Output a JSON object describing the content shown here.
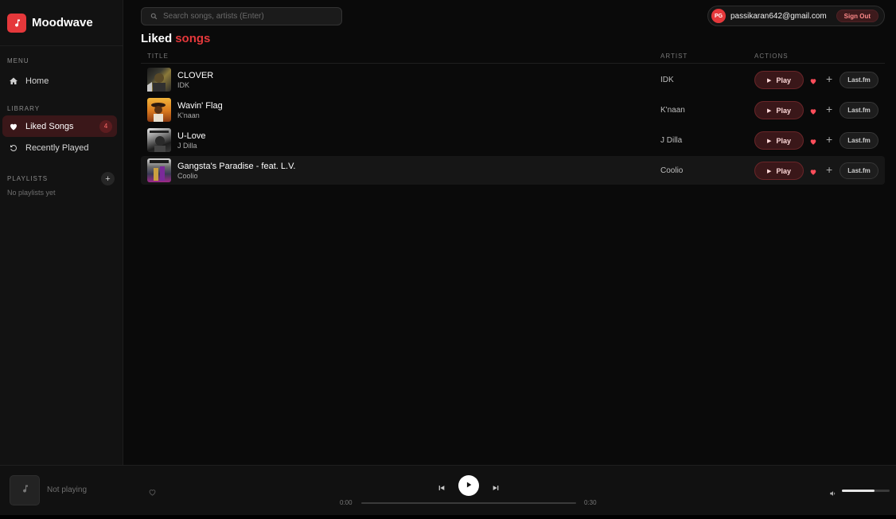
{
  "brand": {
    "name": "Moodwave",
    "icon": "music-note-icon",
    "color": "#e5383b"
  },
  "sidebar": {
    "menu_label": "MENU",
    "home_label": "Home",
    "library_label": "LIBRARY",
    "liked_label": "Liked Songs",
    "liked_count": "4",
    "recent_label": "Recently Played",
    "playlists_label": "PLAYLISTS",
    "add_playlist": "+",
    "no_playlists": "No playlists yet"
  },
  "search": {
    "placeholder": "Search songs, artists (Enter)",
    "value": ""
  },
  "user": {
    "initials": "PG",
    "email": "passikaran642@gmail.com",
    "signout_label": "Sign Out"
  },
  "page": {
    "title_plain": "Liked",
    "title_accent": "songs"
  },
  "table": {
    "columns": {
      "title": "TITLE",
      "artist": "ARTIST",
      "actions": "ACTIONS"
    },
    "play_label": "Play",
    "lastfm_label": "Last.fm",
    "add_label": "+",
    "rows": [
      {
        "title": "CLOVER",
        "subtitle": "IDK",
        "artist": "IDK"
      },
      {
        "title": "Wavin' Flag",
        "subtitle": "K'naan",
        "artist": "K'naan"
      },
      {
        "title": "U-Love",
        "subtitle": "J Dilla",
        "artist": "J Dilla"
      },
      {
        "title": "Gangsta's Paradise - feat. L.V.",
        "subtitle": "Coolio",
        "artist": "Coolio"
      }
    ]
  },
  "player": {
    "now_playing": "Not playing",
    "time_current": "0:00",
    "time_total": "0:30",
    "progress": 0,
    "volume": 0.68
  },
  "colors": {
    "accent": "#e5383b",
    "heart": "#ff4d5a"
  }
}
